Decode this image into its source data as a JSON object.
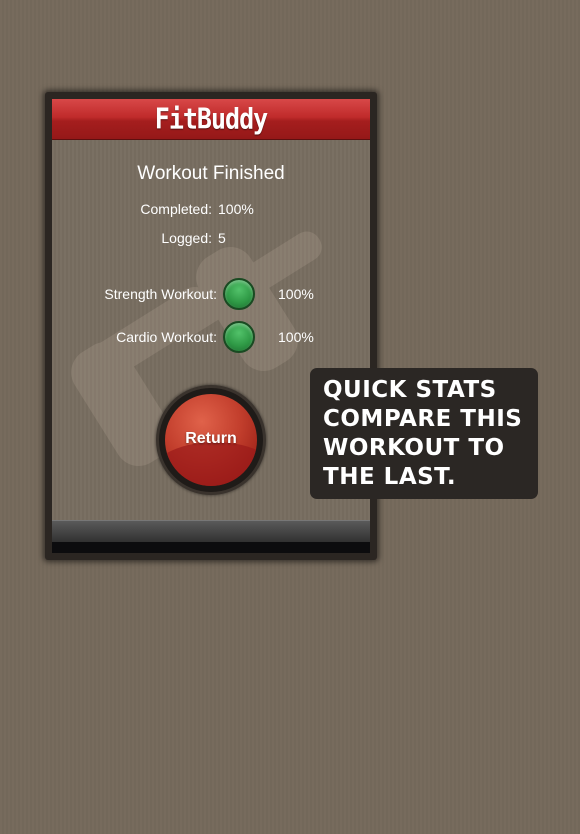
{
  "app": {
    "title": "FitBuddy"
  },
  "summary": {
    "heading": "Workout Finished",
    "completed_label": "Completed:",
    "completed_value": "100%",
    "logged_label": "Logged:",
    "logged_value": "5"
  },
  "workouts": [
    {
      "label": "Strength Workout:",
      "value": "100%",
      "status_color": "#2f9a46"
    },
    {
      "label": "Cardio Workout:",
      "value": "100%",
      "status_color": "#2f9a46"
    }
  ],
  "actions": {
    "return_label": "Return"
  },
  "callout": {
    "text": "QUICK STATS COMPARE THIS WORKOUT TO THE LAST."
  },
  "colors": {
    "titlebar": "#c02b2b",
    "background": "#776b5d",
    "status_complete": "#2f9a46",
    "return_button": "#c33f2d"
  }
}
